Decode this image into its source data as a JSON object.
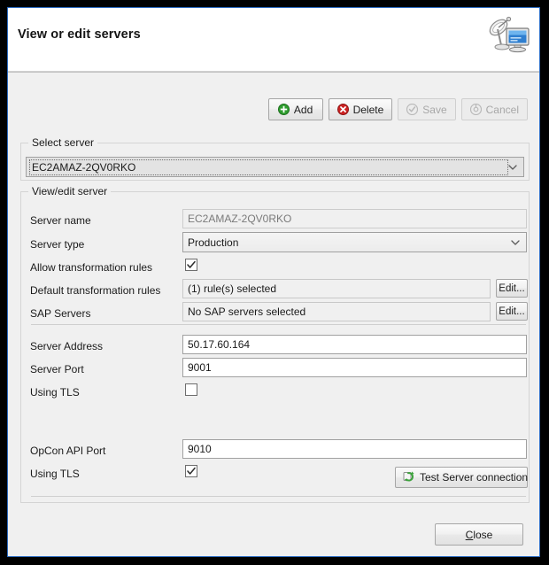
{
  "dialog": {
    "title": "View or edit servers",
    "header_icon": "server-satellite-icon",
    "accent_border": "#2a6ac0"
  },
  "toolbar": {
    "add_label": "Add",
    "add_icon": "plus-circle-green-icon",
    "delete_label": "Delete",
    "delete_icon": "x-circle-red-icon",
    "save_label": "Save",
    "save_icon": "check-circle-icon",
    "cancel_label": "Cancel",
    "cancel_icon": "cancel-circle-icon",
    "add_enabled": true,
    "delete_enabled": true,
    "save_enabled": false,
    "cancel_enabled": false
  },
  "select_server": {
    "legend": "Select server",
    "selected_value": "EC2AMAZ-2QV0RKO",
    "chevron_icon": "chevron-down-icon"
  },
  "view_edit_server": {
    "legend": "View/edit server",
    "fields": {
      "server_name": {
        "label": "Server name",
        "value": "EC2AMAZ-2QV0RKO",
        "readonly": true
      },
      "server_type": {
        "label": "Server type",
        "value": "Production",
        "chevron_icon": "chevron-down-icon"
      },
      "allow_transformation_rules": {
        "label": "Allow transformation rules",
        "checked": true,
        "check_icon": "checkmark-icon"
      },
      "default_transformation_rules": {
        "label": "Default transformation rules",
        "value": "(1) rule(s) selected",
        "edit_label": "Edit..."
      },
      "sap_servers": {
        "label": "SAP Servers",
        "value": "No SAP servers selected",
        "edit_label": "Edit..."
      },
      "server_address": {
        "label": "Server Address",
        "value": "50.17.60.164"
      },
      "server_port": {
        "label": "Server Port",
        "value": "9001"
      },
      "using_tls_server": {
        "label": "Using TLS",
        "checked": false
      },
      "test_connection": {
        "label": "Test Server connection",
        "icon": "refresh-green-icon"
      },
      "opcon_api_port": {
        "label": "OpCon API Port",
        "value": "9010"
      },
      "using_tls_api": {
        "label": "Using TLS",
        "checked": true,
        "check_icon": "checkmark-icon"
      }
    }
  },
  "footer": {
    "close_mnemonic": "C",
    "close_rest": "lose"
  }
}
